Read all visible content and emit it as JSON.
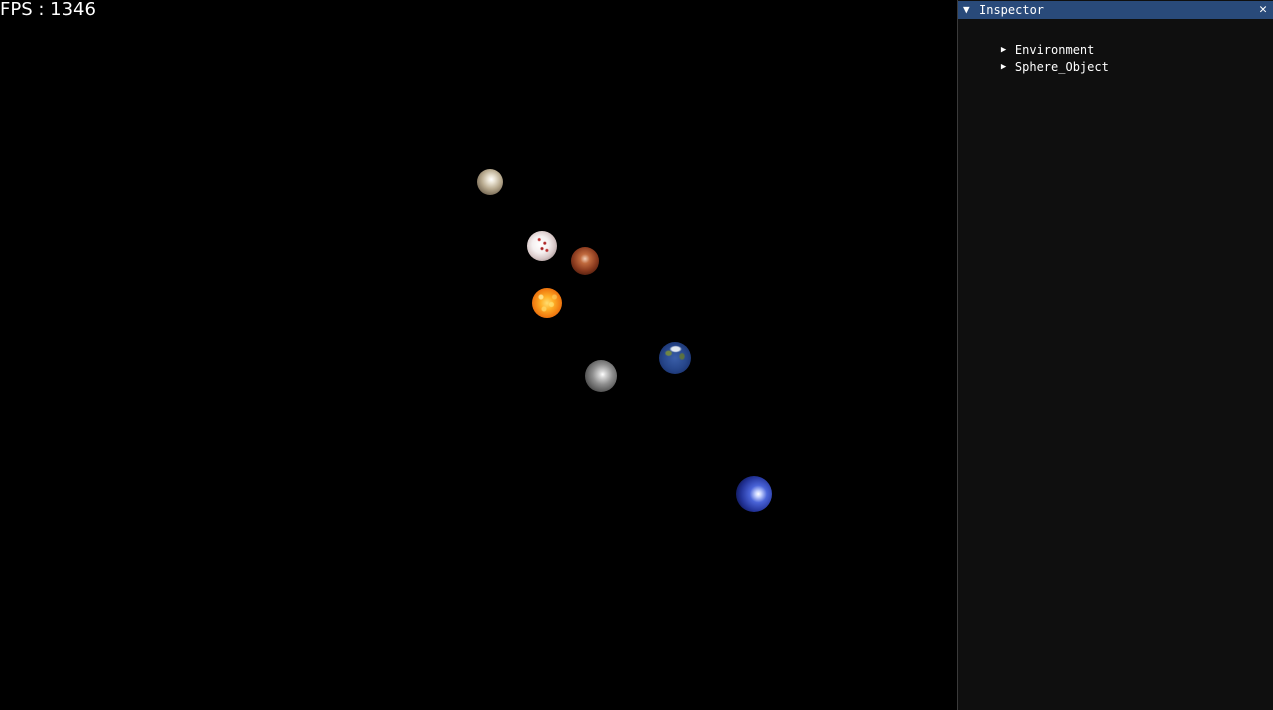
{
  "viewport": {
    "fps_text": "FPS : 1346",
    "planets": [
      {
        "name": "saturn-like",
        "color": "#b9ab90"
      },
      {
        "name": "white-planet",
        "color": "#f5f0f0"
      },
      {
        "name": "mars",
        "color": "#8a3a1e"
      },
      {
        "name": "sun",
        "color": "#f07a10"
      },
      {
        "name": "moon",
        "color": "#8f8f8f"
      },
      {
        "name": "earth",
        "color": "#27478c"
      },
      {
        "name": "neptune",
        "color": "#23349a"
      }
    ]
  },
  "inspector": {
    "title": "Inspector",
    "collapse_icon": "▼",
    "close_icon": "✕",
    "title_bar_color": "#294a7a",
    "nodes": [
      {
        "label": "Environment",
        "icon": "▶"
      },
      {
        "label": "Sphere_Object",
        "icon": "▶"
      }
    ]
  }
}
